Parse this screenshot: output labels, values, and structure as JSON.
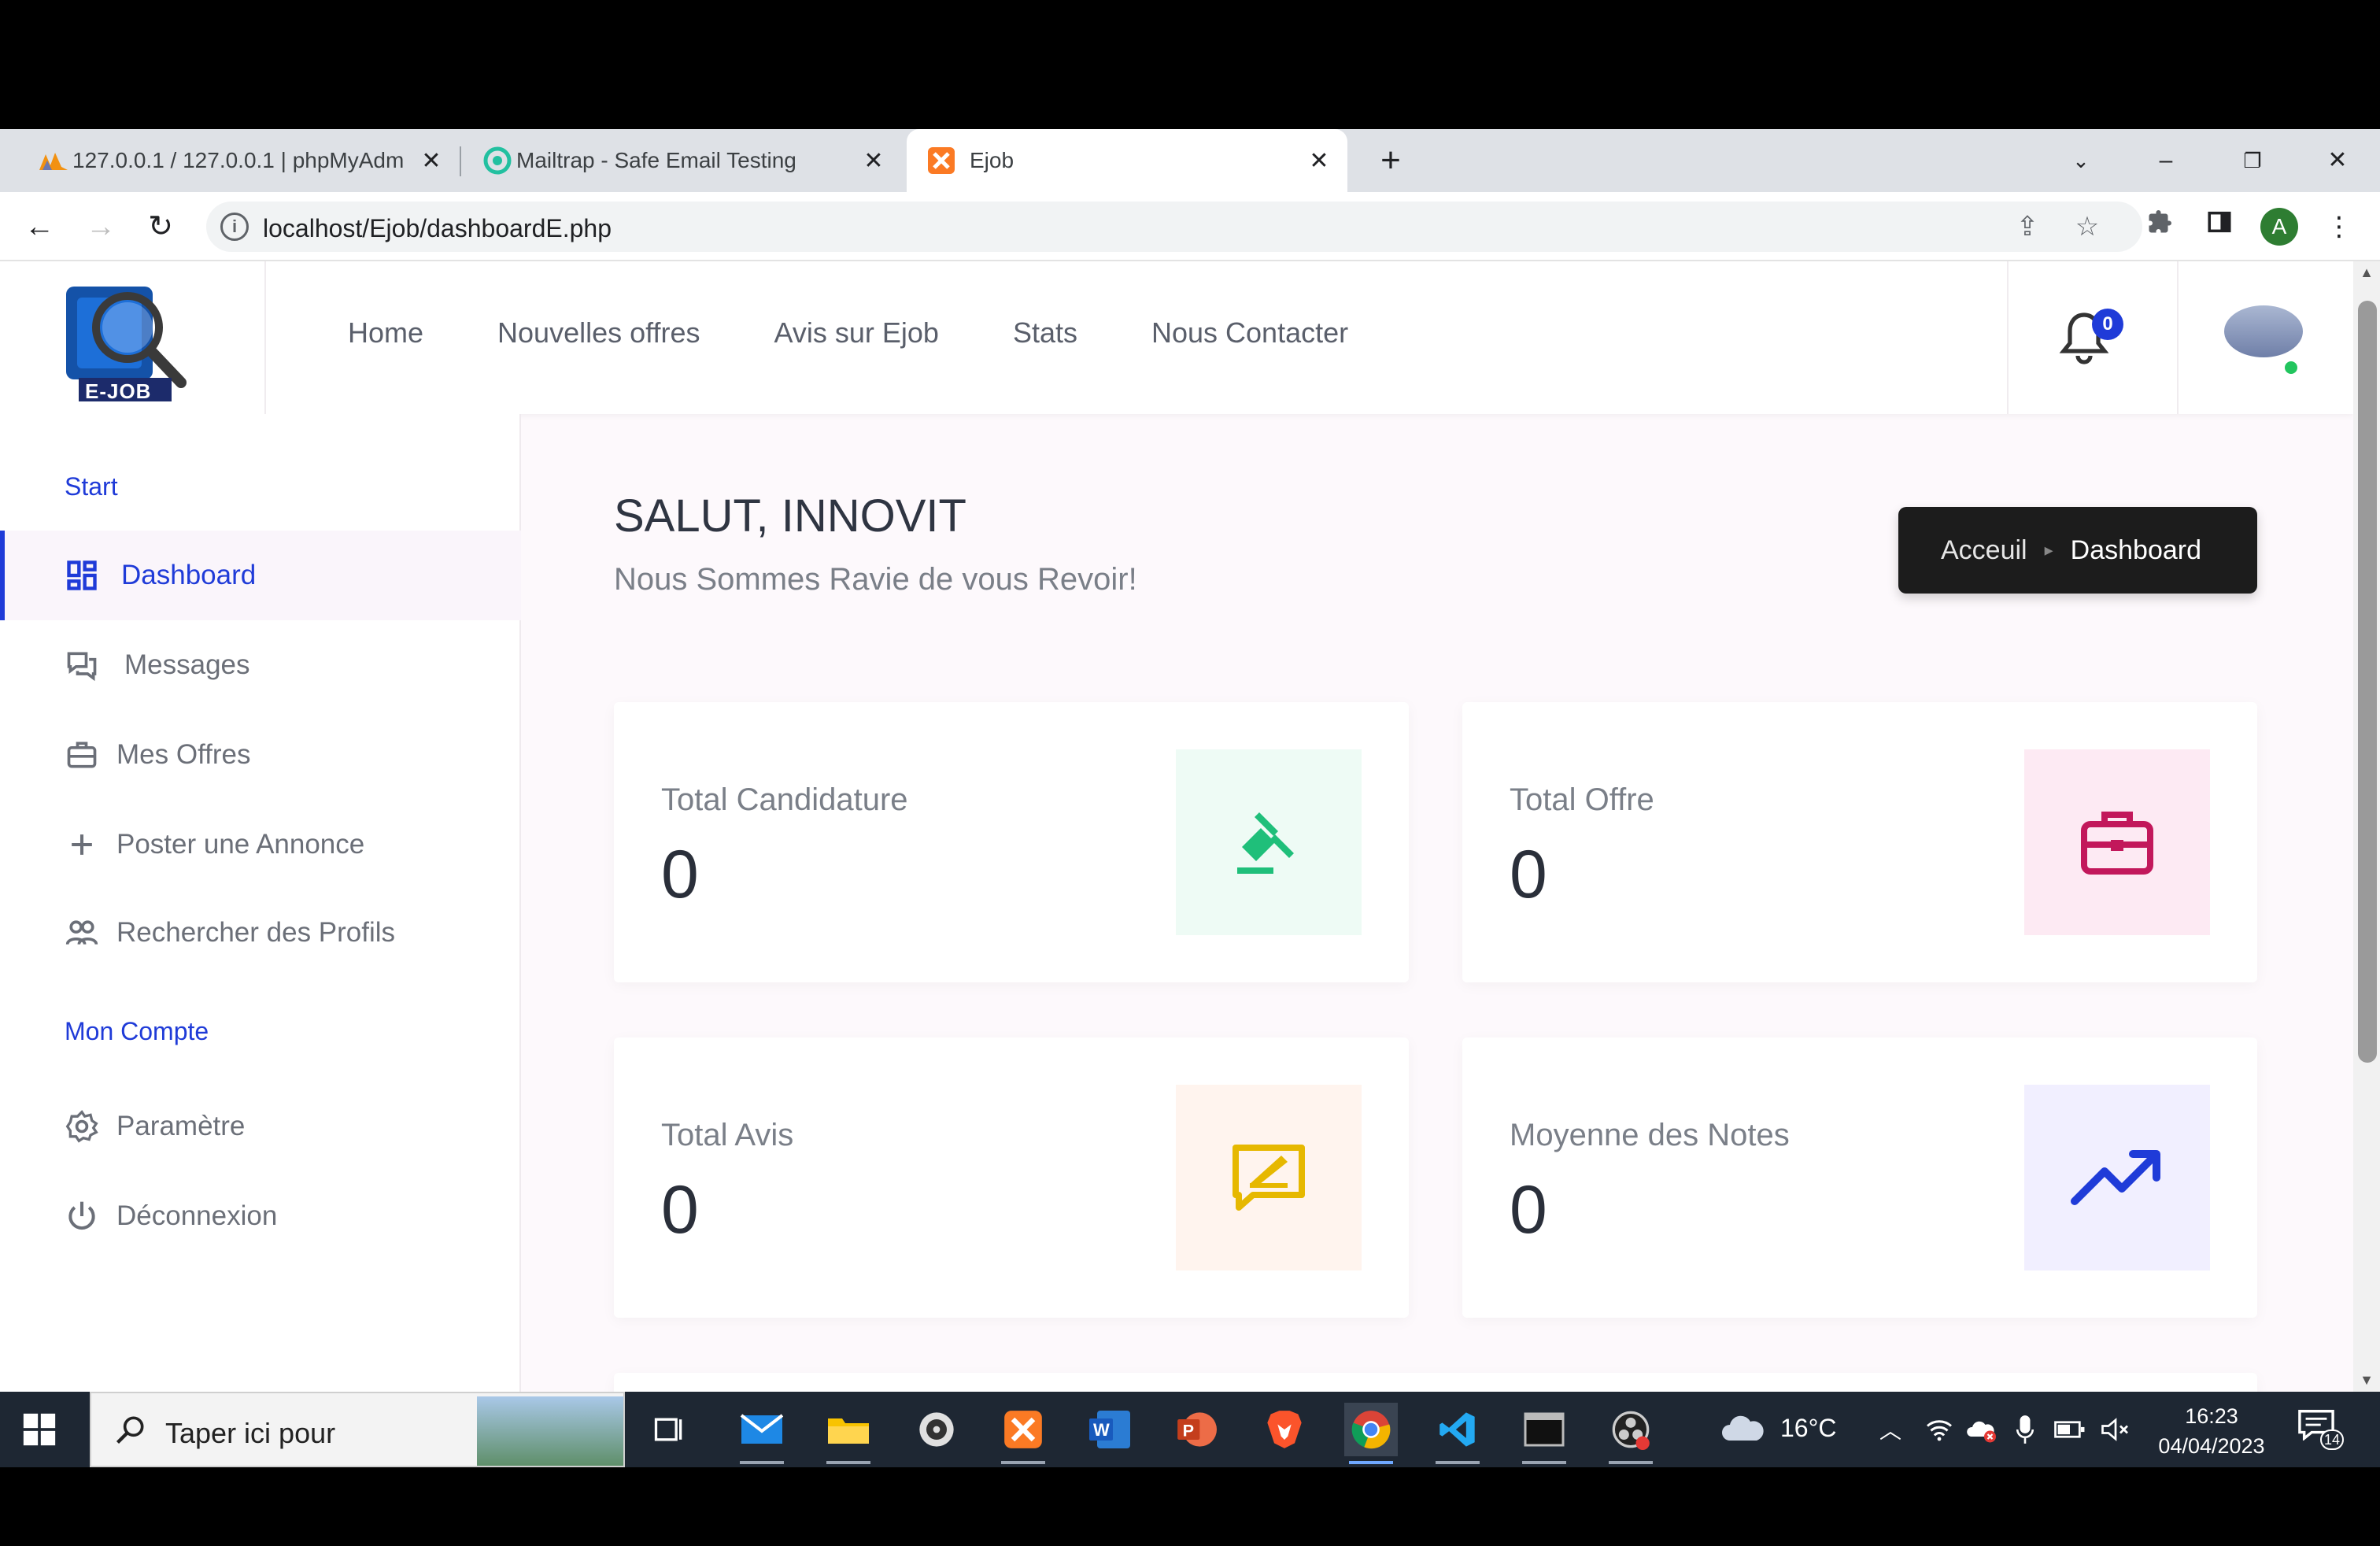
{
  "browser": {
    "tabs": [
      {
        "title": "127.0.0.1 / 127.0.0.1 | phpMyAdm",
        "active": false
      },
      {
        "title": "Mailtrap - Safe Email Testing",
        "active": false
      },
      {
        "title": "Ejob",
        "active": true
      }
    ],
    "url": "localhost/Ejob/dashboardE.php",
    "profile_initial": "A"
  },
  "site": {
    "logo_text": "E-JOB",
    "nav": [
      "Home",
      "Nouvelles offres",
      "Avis sur Ejob",
      "Stats",
      "Nous Contacter"
    ],
    "notification_count": "0"
  },
  "sidebar": {
    "section_start": "Start",
    "items_start": [
      {
        "label": "Dashboard",
        "icon": "dashboard-icon",
        "active": true
      },
      {
        "label": "Messages",
        "icon": "messages-icon"
      },
      {
        "label": "Mes Offres",
        "icon": "briefcase-icon"
      },
      {
        "label": "Poster une Annonce",
        "icon": "plus-icon"
      },
      {
        "label": "Rechercher des Profils",
        "icon": "users-icon"
      }
    ],
    "section_account": "Mon Compte",
    "items_account": [
      {
        "label": "Paramètre",
        "icon": "gear-icon"
      },
      {
        "label": "Déconnexion",
        "icon": "power-icon"
      }
    ]
  },
  "main": {
    "greeting": "SALUT, INNOVIT",
    "subtitle": "Nous Sommes Ravie de vous Revoir!",
    "breadcrumb": [
      "Acceuil",
      "Dashboard"
    ],
    "cards": [
      {
        "title": "Total Candidature",
        "value": "0",
        "icon": "gavel-icon",
        "bg": "#eefbf5",
        "color": "#1fbf7a"
      },
      {
        "title": "Total Offre",
        "value": "0",
        "icon": "briefcase-icon",
        "bg": "#fdeaf3",
        "color": "#c2185b"
      },
      {
        "title": "Total Avis",
        "value": "0",
        "icon": "review-icon",
        "bg": "#fff4ee",
        "color": "#e6b800"
      },
      {
        "title": "Moyenne des Notes",
        "value": "0",
        "icon": "trend-up-icon",
        "bg": "#f1efff",
        "color": "#1f3bd8"
      }
    ]
  },
  "taskbar": {
    "search_placeholder": "Taper ici pour",
    "weather": "16°C",
    "time": "16:23",
    "date": "04/04/2023",
    "notifications": "14"
  }
}
